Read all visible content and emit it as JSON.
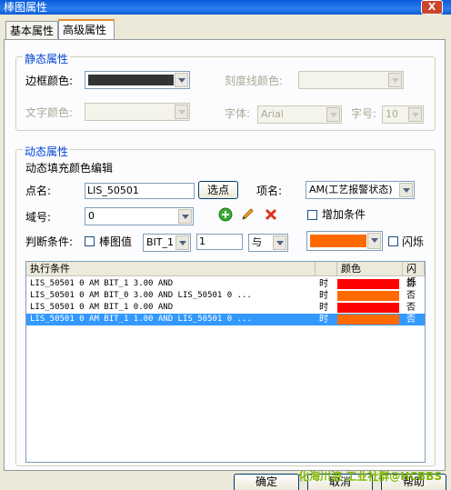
{
  "window": {
    "title": "棒图属性",
    "close_glyph": "X"
  },
  "tabs": [
    {
      "label": "基本属性"
    },
    {
      "label": "高级属性"
    }
  ],
  "static_group": {
    "title": "静态属性",
    "border_color_label": "边框颜色:",
    "border_color_value": "#333333",
    "tick_color_label": "刻度线颜色:",
    "text_color_label": "文字颜色:",
    "font_label": "字体:",
    "font_value": "Arial",
    "size_label": "字号:",
    "size_value": "10"
  },
  "dynamic_group": {
    "title": "动态属性",
    "subtitle": "动态填充颜色编辑",
    "point_label": "点名:",
    "point_value": "LIS_50501",
    "select_point_label": "选点",
    "item_label": "项名:",
    "item_value": "AM(工艺报警状态)",
    "field_label": "域号:",
    "field_value": "0",
    "add_condition_label": "增加条件",
    "judge_label": "判断条件:",
    "bar_value_label": "棒图值",
    "bit_value": "BIT_1",
    "compare_value": "1",
    "logic_value": "与",
    "fill_color": "#ff6a00",
    "flash_label": "闪烁"
  },
  "table": {
    "headers": {
      "condition": "执行条件",
      "color": "颜色",
      "flash": "闪烁"
    },
    "rows": [
      {
        "condition": "LIS_50501 0 AM BIT_1   3.00 AND",
        "when": "时",
        "color": "#ff0000",
        "flash": "否"
      },
      {
        "condition": "LIS_50501 0 AM BIT_0   3.00 AND LIS_50501 0 ...",
        "when": "时",
        "color": "#ff6a00",
        "flash": "否"
      },
      {
        "condition": "LIS_50501 0 AM BIT_1   0.00 AND",
        "when": "时",
        "color": "#ff0000",
        "flash": "否"
      },
      {
        "condition": "LIS_50501 0 AM BIT_1   1.00 AND LIS_50501 0 ...",
        "when": "时",
        "color": "#ff6a00",
        "flash": "否"
      }
    ],
    "selected_color": "#3399ff"
  },
  "buttons": {
    "ok": "确定",
    "cancel": "取消",
    "help": "帮助"
  },
  "watermark": "化海川流 工业社群@HCBBS"
}
